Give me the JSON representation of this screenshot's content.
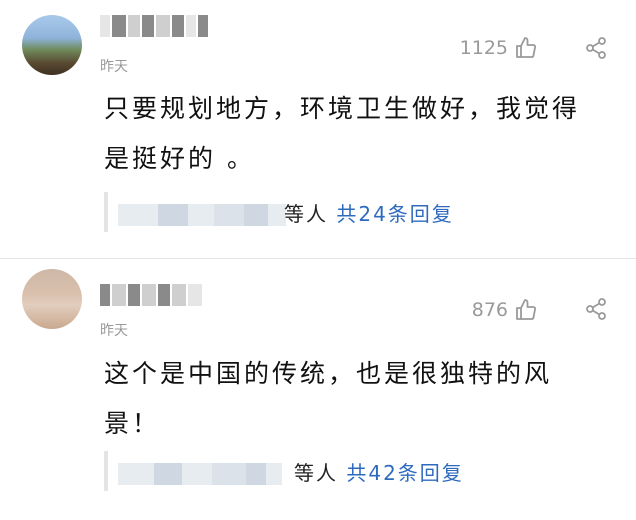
{
  "comments": [
    {
      "time": "昨天",
      "likes": "1125",
      "text": "只要规划地方，环境卫生做好，我觉得是挺好的 。",
      "replies_prefix": "等人",
      "replies_link": "共24条回复"
    },
    {
      "time": "昨天",
      "likes": "876",
      "text": "这个是中国的传统，也是很独特的风景！",
      "replies_prefix": "等人",
      "replies_link": "共42条回复"
    }
  ],
  "colors": {
    "link": "#2e6bbf",
    "meta": "#9a9a9a",
    "text": "#111111"
  },
  "icons": {
    "like": "thumbs-up-icon",
    "share": "share-icon"
  }
}
